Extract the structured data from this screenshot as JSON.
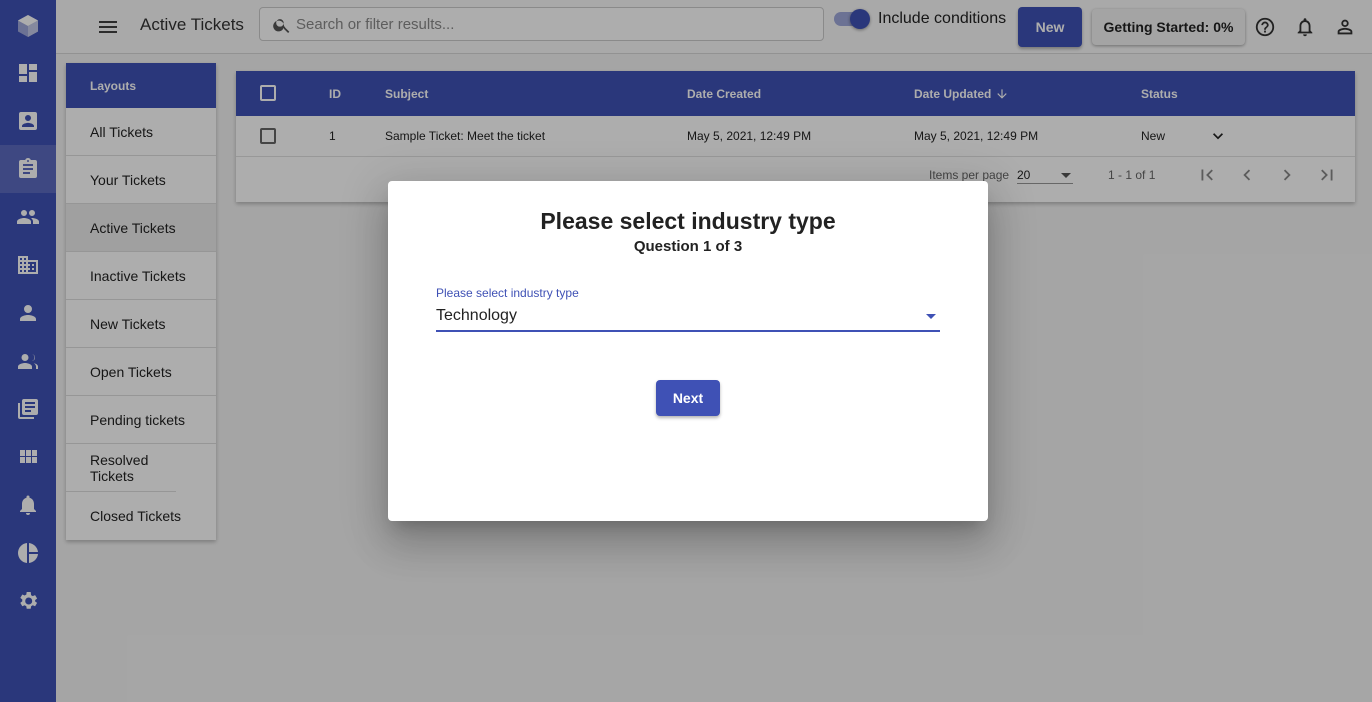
{
  "topbar": {
    "title": "Active Tickets",
    "search_placeholder": "Search or filter results...",
    "include_conditions_label": "Include conditions",
    "include_conditions_on": true,
    "new_button": "New",
    "getting_started_button": "Getting Started: 0%"
  },
  "nav_rail": {
    "icons": [
      "logo-icon",
      "dashboard-icon",
      "contacts-icon",
      "tickets-icon",
      "teams-icon",
      "companies-icon",
      "person-icon",
      "groups-icon",
      "library-icon",
      "apps-icon",
      "notifications-icon",
      "reports-icon",
      "settings-icon"
    ],
    "active": "tickets-icon"
  },
  "layouts": {
    "header": "Layouts",
    "items": [
      "All Tickets",
      "Your Tickets",
      "Active Tickets",
      "Inactive Tickets",
      "New Tickets",
      "Open Tickets",
      "Pending tickets",
      "Resolved Tickets",
      "Closed Tickets"
    ],
    "selected": "Active Tickets"
  },
  "table": {
    "columns": [
      "ID",
      "Subject",
      "Date Created",
      "Date Updated",
      "Status"
    ],
    "sorted_column": "Date Updated",
    "rows": [
      {
        "id": "1",
        "subject": "Sample Ticket: Meet the ticket",
        "date_created": "May 5, 2021, 12:49 PM",
        "date_updated": "May 5, 2021, 12:49 PM",
        "status": "New"
      }
    ]
  },
  "pager": {
    "items_per_page_label": "Items per page",
    "items_per_page_value": "20",
    "range_label": "1 - 1 of 1"
  },
  "dialog": {
    "title": "Please select industry type",
    "subtitle": "Question 1 of 3",
    "field_label": "Please select industry type",
    "field_value": "Technology",
    "next_button": "Next"
  },
  "colors": {
    "primary": "#3f51b5",
    "rail": "#3f51b5",
    "overlay": "rgba(0,0,0,0.32)"
  }
}
